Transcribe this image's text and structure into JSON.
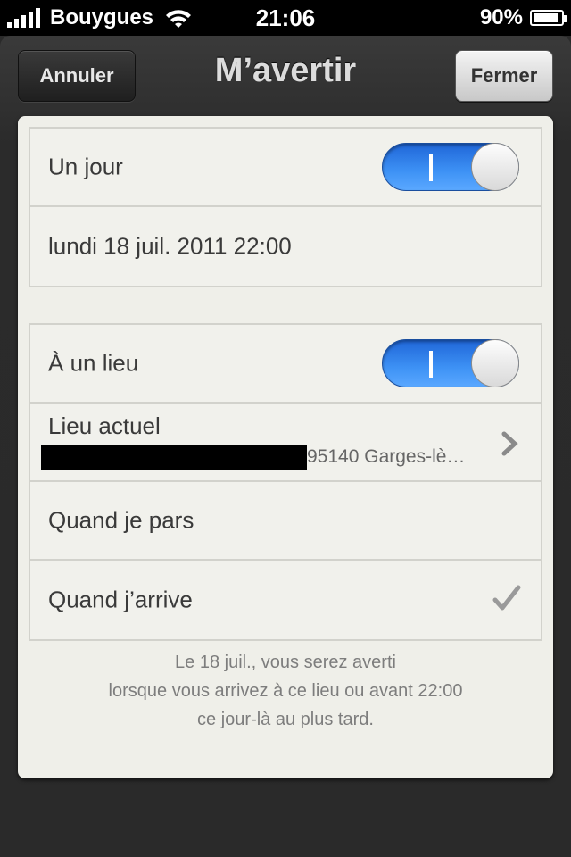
{
  "status_bar": {
    "carrier": "Bouygues",
    "time": "21:06",
    "battery": "90%",
    "battery_level": 0.9,
    "icons": [
      "signal-icon",
      "wifi-icon",
      "battery-icon"
    ]
  },
  "navbar": {
    "title": "M’avertir",
    "cancel_label": "Annuler",
    "close_label": "Fermer"
  },
  "groups": {
    "date": {
      "toggle_label": "Un jour",
      "toggle_on": true,
      "date_value": "lundi 18 juil. 2011 22:00"
    },
    "location": {
      "toggle_label": "À un lieu",
      "toggle_on": true,
      "place_label": "Lieu actuel",
      "place_address": "95140 Garges-lè…",
      "option_leave": "Quand je pars",
      "option_arrive": "Quand j’arrive",
      "selected_option": "Quand j’arrive"
    }
  },
  "footer": {
    "line1": "Le 18 juil., vous serez averti",
    "line2": "lorsque vous arrivez à ce lieu ou avant 22:00",
    "line3": "ce jour-là au plus tard."
  },
  "colors": {
    "toggle_on": "#3e92f5",
    "paper": "#efefe9",
    "leather": "#2a2a2a"
  }
}
